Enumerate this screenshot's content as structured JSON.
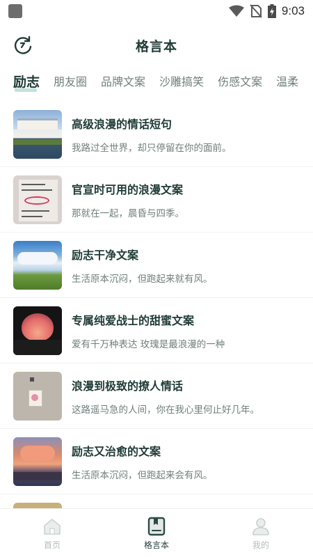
{
  "status_bar": {
    "time": "9:03",
    "icons": [
      "wifi-icon",
      "no-sim-icon",
      "battery-charging-icon"
    ]
  },
  "header": {
    "title": "格言本",
    "left_icon": "refresh-icon"
  },
  "tabs": [
    {
      "label": "励志",
      "active": true
    },
    {
      "label": "朋友圈",
      "active": false
    },
    {
      "label": "品牌文案",
      "active": false
    },
    {
      "label": "沙雕搞笑",
      "active": false
    },
    {
      "label": "伤感文案",
      "active": false
    },
    {
      "label": "温柔",
      "active": false
    }
  ],
  "items": [
    {
      "title": "高级浪漫的情话短句",
      "subtitle": "我路过全世界，却只停留在你的面前。"
    },
    {
      "title": "官宣时可用的浪漫文案",
      "subtitle": "那就在一起，晨昏与四季。"
    },
    {
      "title": "励志干净文案",
      "subtitle": "生活原本沉闷，但跑起来就有风。"
    },
    {
      "title": "专属纯爱战士的甜蜜文案",
      "subtitle": "爱有千万种表达 玫瑰是最浪漫的一种"
    },
    {
      "title": "浪漫到极致的撩人情话",
      "subtitle": "这路遥马急的人间，你在我心里何止好几年。"
    },
    {
      "title": "励志又治愈的文案",
      "subtitle": "生活原本沉闷，但跑起来会有风。"
    }
  ],
  "bottom_nav": [
    {
      "label": "首页",
      "icon": "home-icon",
      "active": false
    },
    {
      "label": "格言本",
      "icon": "notebook-icon",
      "active": true
    },
    {
      "label": "我的",
      "icon": "profile-icon",
      "active": false
    }
  ],
  "colors": {
    "primary_text": "#1f3b36",
    "secondary_text": "#6f7f7c",
    "inactive_nav": "#b3bdbb",
    "tab_underline": "#78beaf"
  }
}
